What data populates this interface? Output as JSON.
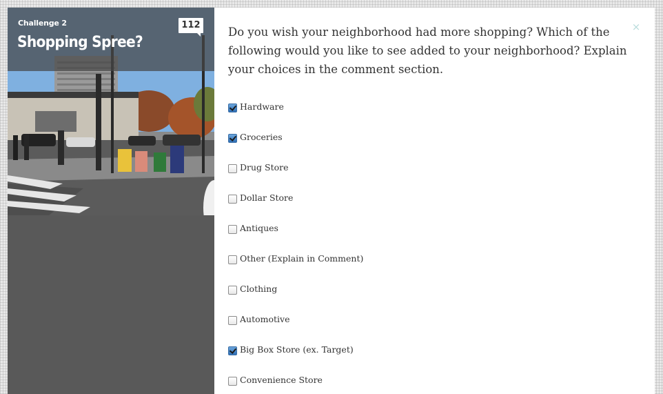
{
  "challenge": {
    "label": "Challenge 2",
    "title": "Shopping Spree?",
    "count": "112"
  },
  "question": {
    "text": "Do you wish your neighborhood had more shopping? Which of the following would you like to see added to your neighborhood? Explain your choices in the comment section.",
    "close_icon": "×"
  },
  "options": [
    {
      "label": "Hardware",
      "checked": true
    },
    {
      "label": "Groceries",
      "checked": true
    },
    {
      "label": "Drug Store",
      "checked": false
    },
    {
      "label": "Dollar Store",
      "checked": false
    },
    {
      "label": "Antiques",
      "checked": false
    },
    {
      "label": "Other (Explain in Comment)",
      "checked": false
    },
    {
      "label": "Clothing",
      "checked": false
    },
    {
      "label": "Automotive",
      "checked": false
    },
    {
      "label": "Big Box Store (ex. Target)",
      "checked": true
    },
    {
      "label": "Convenience Store",
      "checked": false
    }
  ],
  "colors": {
    "left_panel": "#595959",
    "close_icon": "#b9dcdc",
    "checkbox_checked": "#2f6fb5"
  }
}
